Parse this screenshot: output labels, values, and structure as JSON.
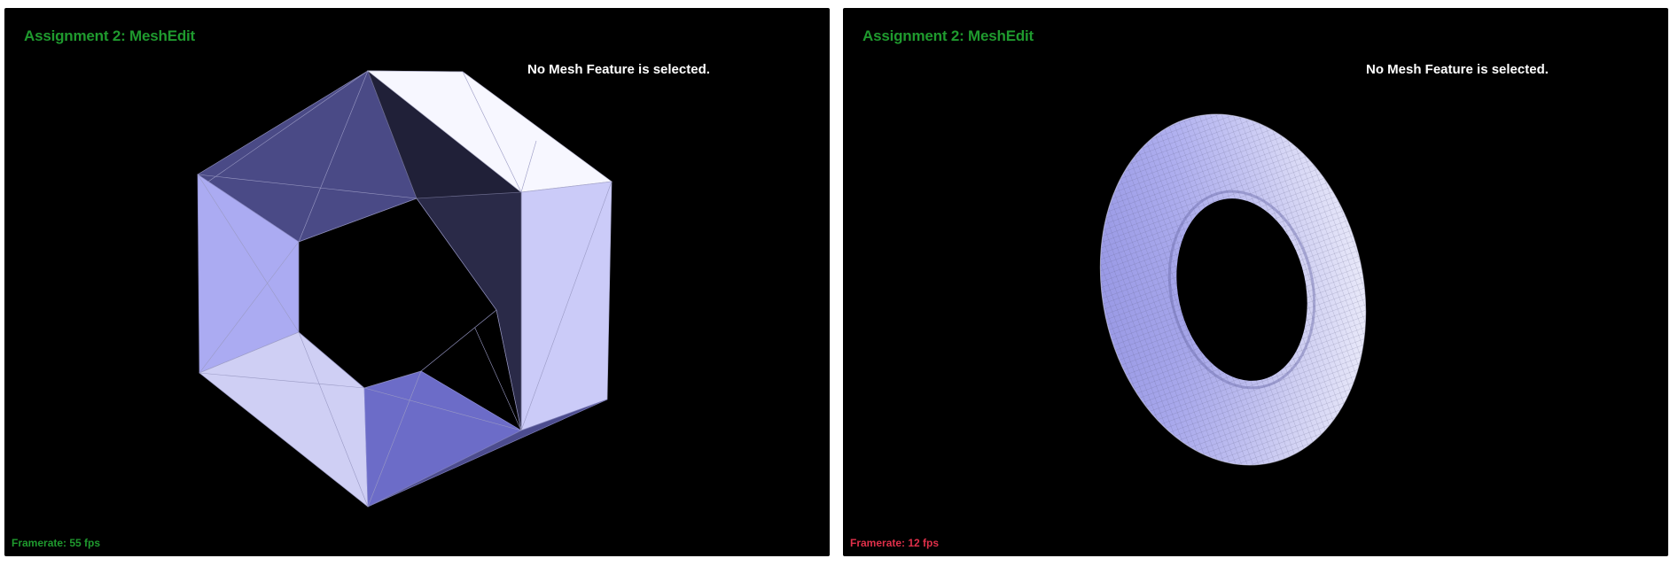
{
  "viewports": [
    {
      "title": "Assignment 2: MeshEdit",
      "status": "No Mesh Feature is selected.",
      "framerate": "Framerate: 55 fps",
      "framerate_color": "#1f9a2e",
      "mesh_name": "low-poly hexagonal torus"
    },
    {
      "title": "Assignment 2: MeshEdit",
      "status": "No Mesh Feature is selected.",
      "framerate": "Framerate: 12 fps",
      "framerate_color": "#e0304a",
      "mesh_name": "subdivided smooth torus"
    }
  ]
}
